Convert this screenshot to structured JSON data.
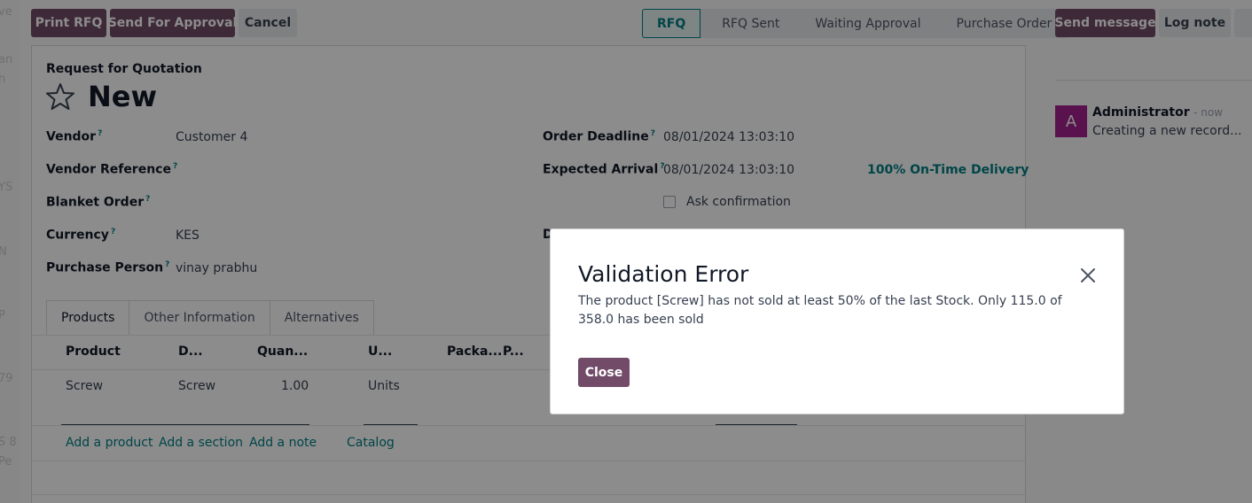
{
  "background_fragments": [
    "ve",
    "an",
    "h",
    "YS",
    "N",
    "P",
    "79",
    "S 8",
    "Pe"
  ],
  "toolbar": {
    "print_rfq": "Print RFQ",
    "send_approval": "Send For Approval",
    "cancel": "Cancel"
  },
  "stages": [
    "RFQ",
    "RFQ Sent",
    "Waiting Approval",
    "Purchase Order"
  ],
  "chatter": {
    "send_message": "Send message",
    "log_note": "Log note",
    "author": "Administrator",
    "time": "- now",
    "avatar_letter": "A",
    "message": "Creating a new record..."
  },
  "form": {
    "doc_type": "Request for Quotation",
    "title": "New",
    "help_mark": "?",
    "vendor_label": "Vendor",
    "vendor_value": "Customer 4",
    "vendor_ref_label": "Vendor Reference",
    "blanket_label": "Blanket Order",
    "currency_label": "Currency",
    "currency_value": "KES",
    "purchase_person_label": "Purchase Person",
    "purchase_person_value": "vinay prabhu",
    "order_deadline_label": "Order Deadline",
    "order_deadline_value": "08/01/2024 13:03:10",
    "expected_arrival_label": "Expected Arrival",
    "expected_arrival_value": "08/01/2024 13:03:10",
    "on_time": "100% On-Time Delivery",
    "ask_confirmation": "Ask confirmation",
    "hidden_label_fragment": "D"
  },
  "tabs": [
    "Products",
    "Other Information",
    "Alternatives"
  ],
  "lines": {
    "headers": [
      "Product",
      "D...",
      "Quan...",
      "U...",
      "Packa...",
      "P..."
    ],
    "rows": [
      {
        "product": "Screw",
        "description": "Screw",
        "quantity": "1.00",
        "uom": "Units"
      }
    ],
    "actions": [
      "Add a product",
      "Add a section",
      "Add a note",
      "Catalog"
    ]
  },
  "dialog": {
    "title": "Validation Error",
    "message": "The product [Screw] has not sold at least 50% of the last Stock. Only 115.0 of 358.0 has been sold",
    "close_label": "Close"
  }
}
